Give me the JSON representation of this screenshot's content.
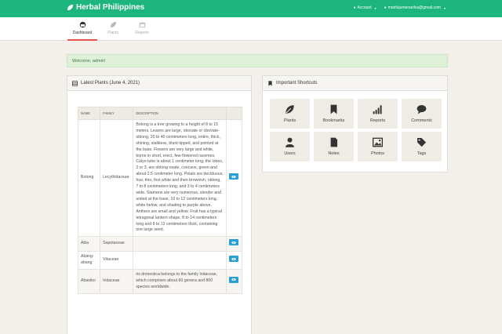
{
  "navbar": {
    "brand": "Herbal Philippines",
    "account_label": "Account",
    "email": "marifujumenarilva@gmail.com"
  },
  "tabs": [
    {
      "label": "Dashboard",
      "icon": "dashboard-icon"
    },
    {
      "label": "Plants",
      "icon": "leaf-icon"
    },
    {
      "label": "Reports",
      "icon": "calendar-icon"
    }
  ],
  "alert": {
    "text": "Welcome, admin!"
  },
  "plants_panel": {
    "title": "Latest Plants (June 4, 2021)",
    "columns": [
      "NAME",
      "FAMILY",
      "DESCRIPTION"
    ],
    "rows": [
      {
        "name": "Botong",
        "family": "Lecythidaceae",
        "description": "Botong is a tree growing to a height of 8 to 15 meters. Leaves are large, obovate or obovate-oblong, 20 to 40 centimeters long, entire, thick, shining, stalkless, blunt-tipped, and pointed at the base. Flowers are very large and white, borne in short, erect, few-flowered racemes. Calyx-tube is about 1 centimeter long; the lobes, 2 or 3, are oblong-ovate, concave, green and about 2.5 centimeter long. Petals are deciduous, four, thin, first white and then brownish, oblong, 7 to 8 centimeters long, and 3 to 4 centimeters wide. Stamens are very numerous, slender and united at the base, 10 to 12 centimeters long, white below, and shading to purple above. Anthers are small and yellow. Fruit has a typical tetragonal lantern shape, 8 to 14 centimeters long and 8 to 12 centimeters thick, containing one large seed."
      },
      {
        "name": "Abiu",
        "family": "Sapotaceae",
        "description": ""
      },
      {
        "name": "Abang-abang",
        "family": "Vitaceae",
        "description": ""
      },
      {
        "name": "Abaniko",
        "family": "Iridaceae",
        "description": "ris domestica belongs to the family Iridaceae, which comprises about 60 genera and 800 species worldwide."
      }
    ]
  },
  "shortcuts_panel": {
    "title": "Important Shortcuts",
    "items": [
      {
        "label": "Plants",
        "icon": "leaf-icon"
      },
      {
        "label": "Bookmarks",
        "icon": "bookmark-icon"
      },
      {
        "label": "Reports",
        "icon": "signal-bars-icon"
      },
      {
        "label": "Comments",
        "icon": "comment-icon"
      },
      {
        "label": "Users",
        "icon": "user-icon"
      },
      {
        "label": "Notes",
        "icon": "file-icon"
      },
      {
        "label": "Photos",
        "icon": "image-icon"
      },
      {
        "label": "Tags",
        "icon": "tag-icon"
      }
    ]
  },
  "colors": {
    "navbar": "#1bb57d",
    "alert_bg": "#dff0d8",
    "view_button": "#2a9fd8",
    "active_tab": "#e5534b"
  }
}
